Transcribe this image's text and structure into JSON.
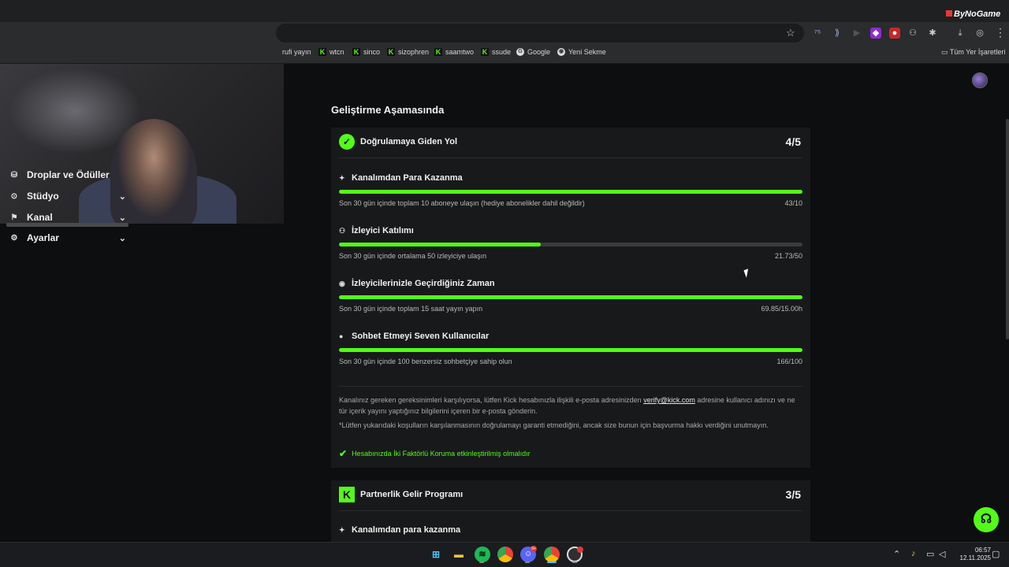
{
  "browser": {
    "brand": "ByNoGame",
    "bookmarks": [
      {
        "label": "rufi yayın",
        "icon": "kick"
      },
      {
        "label": "wtcn",
        "icon": "kick"
      },
      {
        "label": "sinco",
        "icon": "kick"
      },
      {
        "label": "sizophren",
        "icon": "kick"
      },
      {
        "label": "saamtwo",
        "icon": "kick"
      },
      {
        "label": "ssude",
        "icon": "kick"
      },
      {
        "label": "Google",
        "icon": "google"
      },
      {
        "label": "Yeni Sekme",
        "icon": "chrome"
      }
    ],
    "all_bookmarks": "Tüm Yer İşaretleri"
  },
  "sidebar": {
    "items": [
      {
        "label": "Droplar ve Ödüller",
        "icon": "gift-icon",
        "expandable": false
      },
      {
        "label": "Stüdyo",
        "icon": "studio-icon",
        "expandable": true
      },
      {
        "label": "Kanal",
        "icon": "channel-icon",
        "expandable": true
      },
      {
        "label": "Ayarlar",
        "icon": "gear-icon",
        "expandable": true
      }
    ]
  },
  "main": {
    "section_title": "Geliştirme Aşamasında",
    "verification": {
      "title": "Doğrulamaya Giden Yol",
      "score": "4/5",
      "requirements": [
        {
          "title": "Kanalımdan Para Kazanma",
          "desc": "Son 30 gün içinde toplam 10 aboneye ulaşın (hediye abonelikler dahil değildir)",
          "value": "43/10",
          "progress": 1.0
        },
        {
          "title": "İzleyici Katılımı",
          "desc": "Son 30 gün içinde ortalama 50 izleyiciye ulaşın",
          "value": "21.73/50",
          "progress": 0.4346
        },
        {
          "title": "İzleyicilerinizle Geçirdiğiniz Zaman",
          "desc": "Son 30 gün içinde toplam 15 saat yayın yapın",
          "value": "69.85/15.00h",
          "progress": 1.0
        },
        {
          "title": "Sohbet Etmeyi Seven Kullanıcılar",
          "desc": "Son 30 gün içinde 100 benzersiz sohbetçiye sahip olun",
          "value": "166/100",
          "progress": 1.0
        }
      ],
      "note1_pre": "Kanalınız gereken gereksinimleri karşılıyorsa, lütfen Kick hesabınızla ilişkili e-posta adresinizden",
      "note1_link": "verify@kick.com",
      "note1_post": "adresine kullanıcı adınızı ve ne tür içerik yayını yaptığınız bilgilerini içeren bir e-posta gönderin.",
      "note2": "*Lütfen yukarıdaki koşulların karşılanmasının doğrulamayı garanti etmediğini, ancak size bunun için başvurma hakkı verdiğini unutmayın.",
      "twofa": "Hesabınızda İki Faktörlü Koruma etkinleştirilmiş olmalıdır"
    },
    "partner": {
      "title": "Partnerlik Gelir Programı",
      "score": "3/5",
      "first_requirement": "Kanalımdan para kazanma"
    }
  },
  "taskbar": {
    "discord_badge": "9+",
    "time": "06:57",
    "date": "12.11.2025"
  },
  "colors": {
    "accent": "#53fc18",
    "card_bg": "#18191b",
    "page_bg": "#0d0e0f"
  }
}
